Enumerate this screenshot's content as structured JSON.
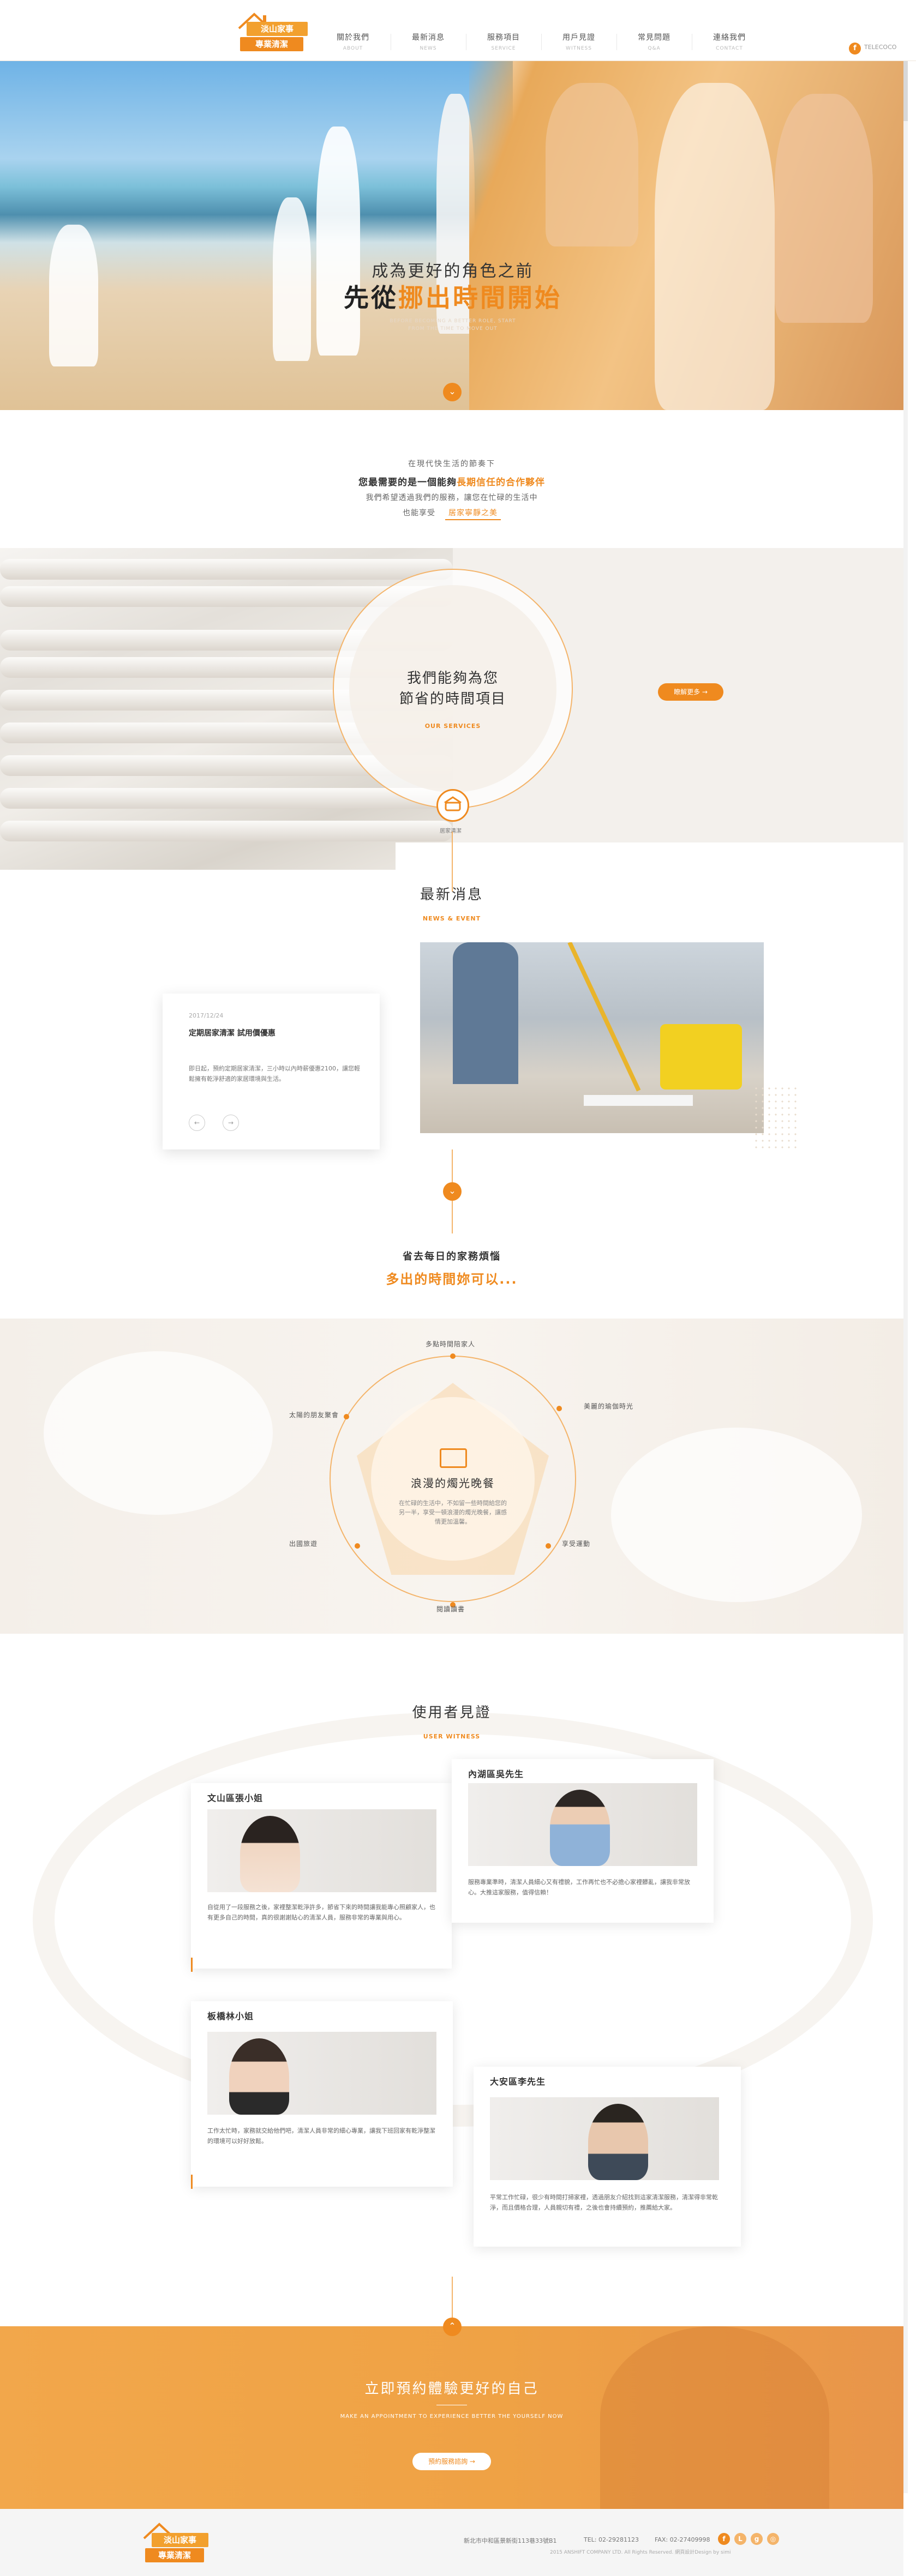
{
  "brand": {
    "logo_line1": "淡山家事",
    "logo_line2": "專業清潔",
    "logo_mark_color": "#ef8a1f"
  },
  "nav": [
    {
      "zh": "關於我們",
      "en": "ABOUT"
    },
    {
      "zh": "最新消息",
      "en": "NEWS"
    },
    {
      "zh": "服務項目",
      "en": "SERVICE"
    },
    {
      "zh": "用戶見證",
      "en": "WITNESS"
    },
    {
      "zh": "常見問題",
      "en": "Q&A"
    },
    {
      "zh": "連絡我們",
      "en": "CONTACT"
    }
  ],
  "header": {
    "facebook_icon": "facebook-icon",
    "phone_label": "TELECOCO"
  },
  "hero": {
    "line1": "成為更好的角色之前",
    "line2_prefix": "先從",
    "line2_highlight": "挪出時間開始",
    "sub": "BEFORE BECOMING A BETTER ROLE, START FROM THE TIME TO MOVE OUT",
    "arrow": "⌄"
  },
  "intro": {
    "line1": "在現代快生活的節奏下",
    "line2_prefix": "您最需要的是一個能夠",
    "line2_highlight": "長期信任的合作夥伴",
    "line3": "我們希望透過我們的服務，讓您在忙碌的生活中",
    "line4": "也能享受",
    "link": "居家寧靜之美"
  },
  "services": {
    "title_line1": "我們能夠為您",
    "title_line2": "節省的時間項目",
    "tag": "OUR SERVICES",
    "icon_label": "居家清潔",
    "more": "瞭解更多 →"
  },
  "news": {
    "title": "最新消息",
    "tag": "NEWS & EVENT",
    "date": "2017/12/24",
    "headline": "定期居家清潔 試用價優惠",
    "body": "即日起，預約定期居家清潔，三小時以內時薪優惠2100，讓您輕鬆擁有乾淨舒適的家居環境與生活。",
    "prev": "←",
    "next": "→"
  },
  "mid": {
    "arrow": "⌄",
    "line1": "省去每日的家務煩惱",
    "line2": "多出的時間妳可以..."
  },
  "benefits": {
    "title": "浪漫的燭光晚餐",
    "text": "在忙碌的生活中，不如留一些時間給您的另一半，享受一頓浪漫的燭光晚餐，讓感情更加溫馨。",
    "items": [
      "多點時間陪家人",
      "美麗的瑜伽時光",
      "享受運動",
      "閱讀讀書",
      "出國旅遊",
      "太陽的朋友聚會"
    ]
  },
  "testimonials": {
    "title": "使用者見證",
    "tag": "USER WITNESS",
    "cards": [
      {
        "name": "文山區張小姐",
        "text": "自從用了一段服務之後，家裡整潔乾淨許多，節省下來的時間讓我能專心照顧家人，也有更多自己的時間，真的很謝謝貼心的清潔人員，服務非常的專業與用心。"
      },
      {
        "name": "內湖區吳先生",
        "text": "服務專業準時，清潔人員細心又有禮貌，工作再忙也不必擔心家裡髒亂，讓我非常放心。大推這家服務，值得信賴！"
      },
      {
        "name": "板橋林小姐",
        "text": "工作太忙時，家務就交給他們吧，清潔人員非常的細心專業，讓我下班回家有乾淨整潔的環境可以好好放鬆。"
      },
      {
        "name": "大安區李先生",
        "text": "平常工作忙碌，很少有時間打掃家裡，透過朋友介紹找到這家清潔服務，清潔得非常乾淨，而且價格合理，人員親切有禮，之後也會持續預約，推薦給大家。"
      }
    ]
  },
  "cta": {
    "arrow": "⌃",
    "title": "立即預約體驗更好的自己",
    "sub": "MAKE AN APPOINTMENT TO EXPERIENCE BETTER THE YOURSELF NOW",
    "button": "預約服務諮詢 →"
  },
  "footer": {
    "address": "新北市中和區景新街113巷33號B1",
    "tel": "TEL: 02-29281123",
    "fax": "FAX: 02-27409998",
    "copyright": "2015 ANSHIFT COMPANY LTD. All Rights Reserved. 網頁設計Design by simi",
    "social": [
      "facebook-icon",
      "line-icon",
      "google-plus-icon",
      "instagram-icon"
    ]
  },
  "colors": {
    "accent": "#ef8a1f",
    "accent_light": "#f4b46a"
  }
}
